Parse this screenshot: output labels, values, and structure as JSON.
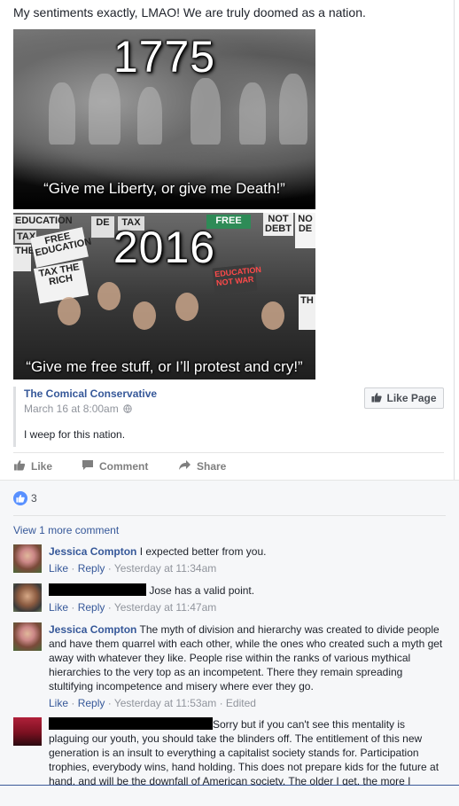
{
  "post": {
    "text": "My sentiments exactly, LMAO! We are truly doomed as a nation."
  },
  "meme": {
    "top_year": "1775",
    "top_caption": "“Give me Liberty, or give me Death!”",
    "bottom_year": "2016",
    "bottom_caption": "“Give me free stuff, or I’ll protest and cry!”",
    "signs": [
      "EDUCATION",
      "TAX",
      "THE",
      "FREE EDUCATION",
      "TAX THE RICH",
      "DE",
      "TAX",
      "FREE",
      "NOT DEBT",
      "NO DE",
      "EDUCATION NOT WAR",
      "TH"
    ]
  },
  "shared": {
    "page_name": "The Comical Conservative",
    "date": "March 16 at 8:00am",
    "privacy_icon": "globe-icon",
    "text": "I weep for this nation.",
    "like_page_label": "Like Page"
  },
  "actions": {
    "like": "Like",
    "comment": "Comment",
    "share": "Share"
  },
  "reactions": {
    "count": "3"
  },
  "view_more": "View 1 more comment",
  "comments": [
    {
      "name": "Jessica Compton",
      "text": "I expected better from you.",
      "like": "Like",
      "reply": "Reply",
      "time": "Yesterday at 11:34am",
      "edited": ""
    },
    {
      "name": "",
      "text": "Jose has a valid point.",
      "like": "Like",
      "reply": "Reply",
      "time": "Yesterday at 11:47am",
      "edited": ""
    },
    {
      "name": "Jessica Compton",
      "text": "The myth of division and hierarchy was created to divide people and have them quarrel with each other, while the ones who created such a myth get away with whatever they like. People rise within the ranks of various mythical hierarchies to the very top as an incompetent. There they remain spreading stultifying incompetence and misery where ever they go.",
      "like": "Like",
      "reply": "Reply",
      "time": "Yesterday at 11:53am",
      "edited": "Edited"
    },
    {
      "name": "",
      "text": "Sorry but if you can't see this mentality is plaguing our youth, you should take the blinders off. The entitlement of this new generation is an insult to everything a capitalist society stands for. Participation trophies, everybody wins, hand holding. This does not prepare kids for the future at hand, and will be the downfall of American society. The older I get, the more I"
    }
  ],
  "colors": {
    "link": "#365899",
    "meta": "#90949c",
    "text": "#1d2129",
    "like_blue": "#5890ff"
  }
}
